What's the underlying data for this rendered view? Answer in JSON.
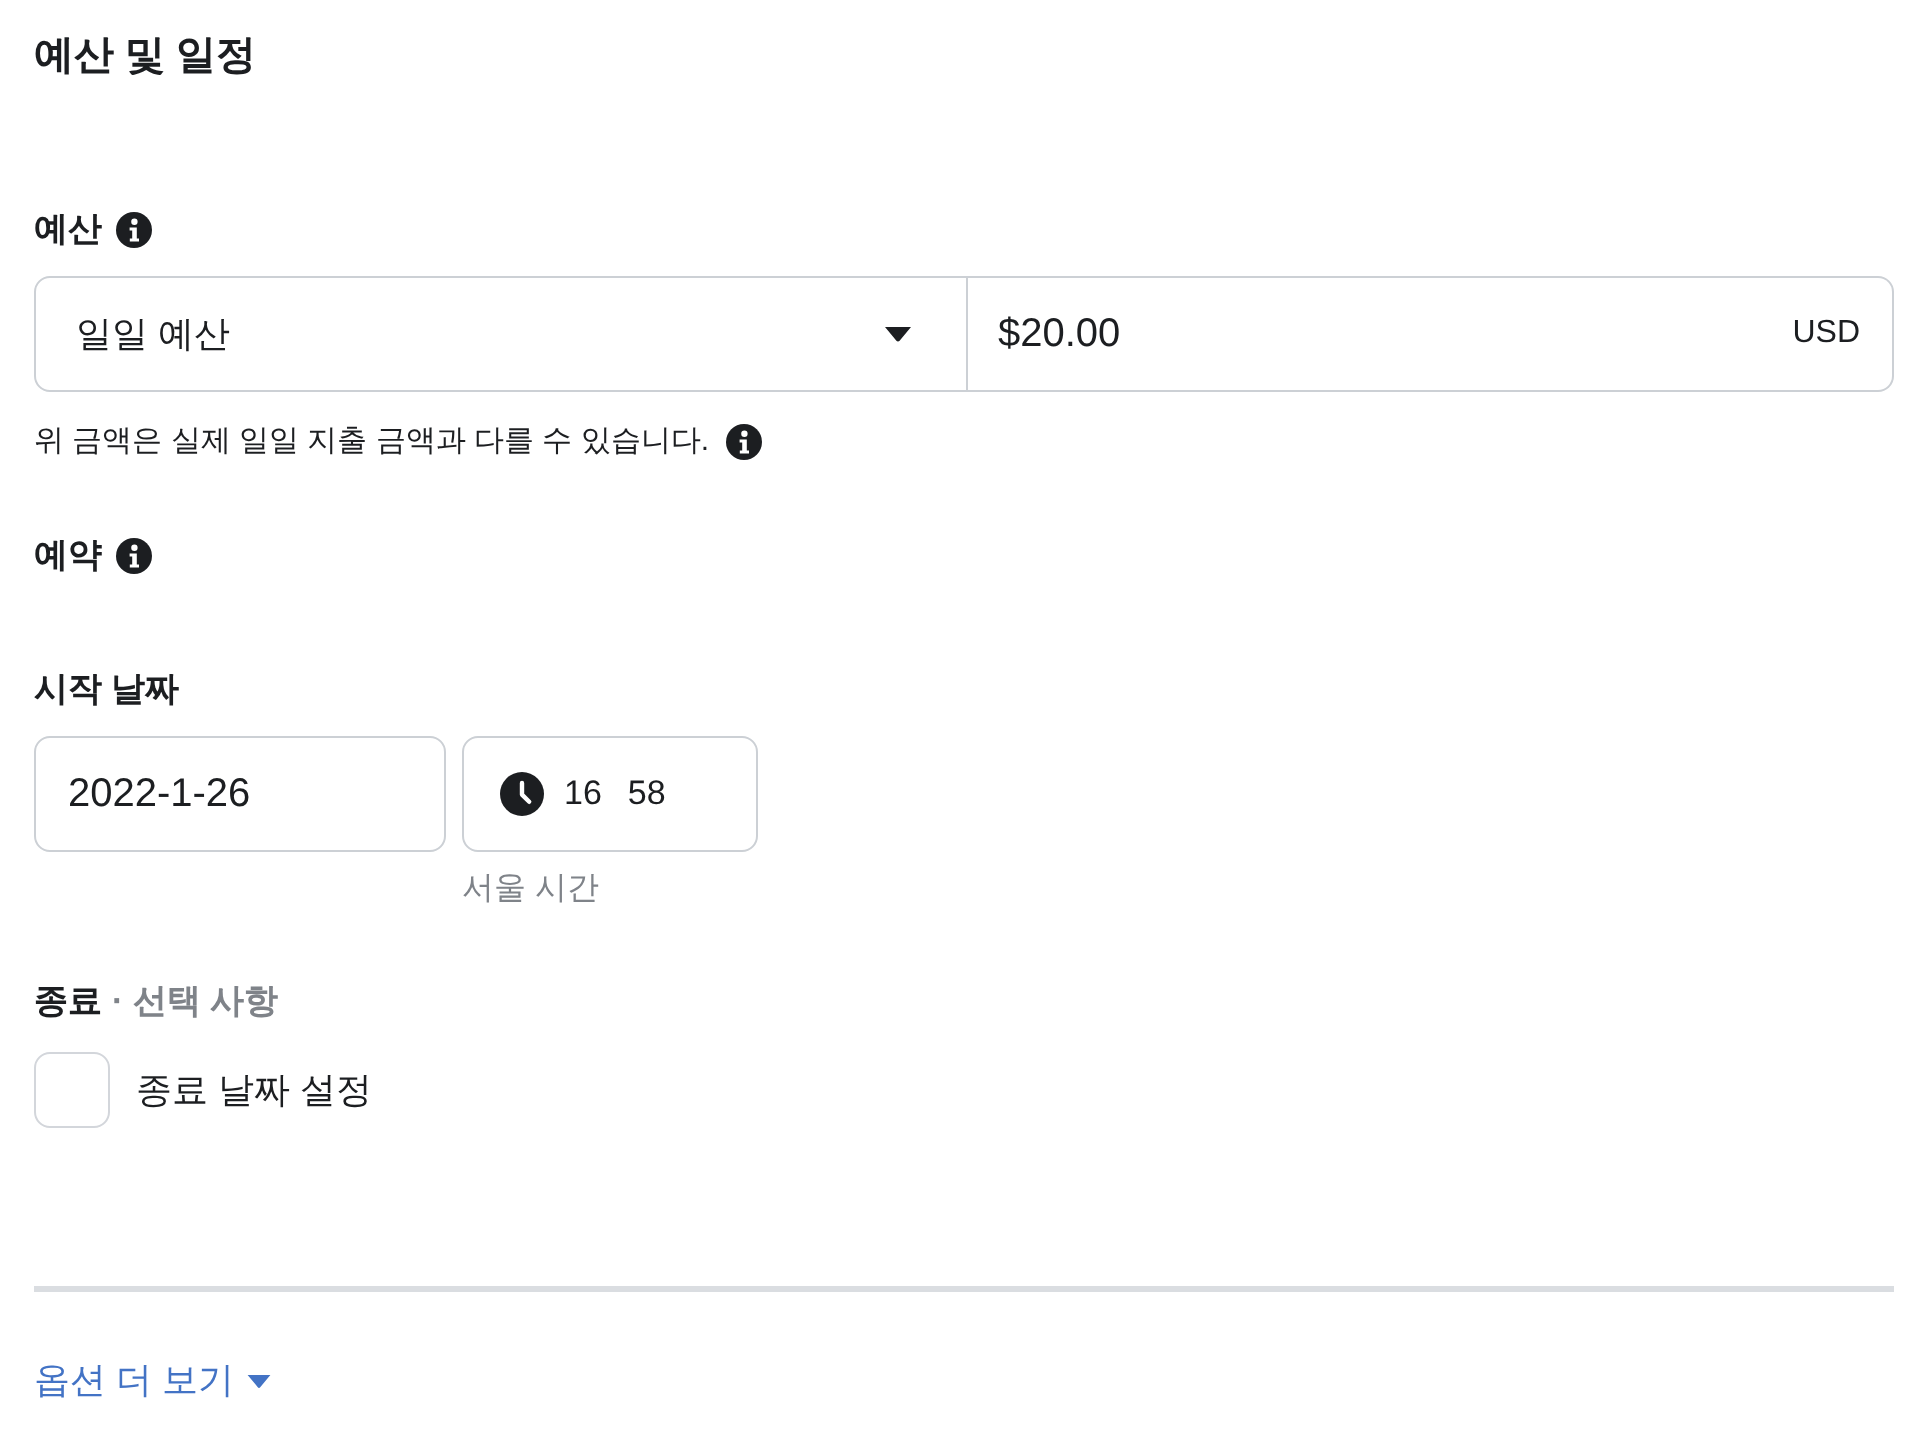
{
  "section": {
    "title": "예산 및 일정"
  },
  "budget": {
    "label": "예산",
    "type_select": {
      "value": "일일 예산"
    },
    "amount": {
      "value": "$20.00",
      "currency": "USD"
    },
    "note": "위 금액은 실제 일일 지출 금액과 다를 수 있습니다."
  },
  "schedule": {
    "label": "예약"
  },
  "start": {
    "label": "시작 날짜",
    "date": "2022-1-26",
    "hour": "16",
    "minute": "58",
    "timezone": "서울 시간"
  },
  "end": {
    "label": "종료",
    "optional": "· 선택 사항",
    "checkbox": {
      "label": "종료 날짜 설정",
      "checked": false
    }
  },
  "more_options": {
    "label": "옵션 더 보기"
  }
}
